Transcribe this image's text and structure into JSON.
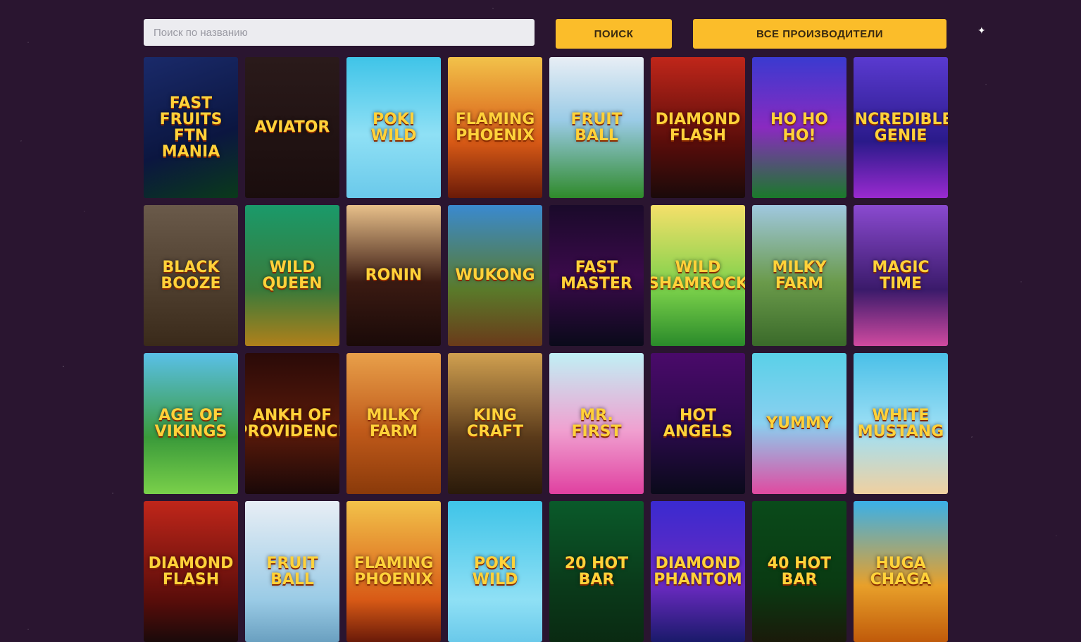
{
  "search": {
    "placeholder": "Поиск по названию",
    "value": ""
  },
  "buttons": {
    "search_label": "ПОИСК",
    "providers_label": "ВСЕ ПРОИЗВОДИТЕЛИ"
  },
  "colors": {
    "background": "#2a1530",
    "accent": "#fbbd2a",
    "input_bg": "#ececf0"
  },
  "games": [
    {
      "title": "Fast Fruits FTN Mania"
    },
    {
      "title": "Aviator"
    },
    {
      "title": "Poki Wild"
    },
    {
      "title": "Flaming Phoenix"
    },
    {
      "title": "Fruit Ball"
    },
    {
      "title": "Diamond Flash"
    },
    {
      "title": "Ho Ho Ho!"
    },
    {
      "title": "Incredible Genie"
    },
    {
      "title": "Black Booze"
    },
    {
      "title": "Wild Queen"
    },
    {
      "title": "Ronin"
    },
    {
      "title": "Wukong"
    },
    {
      "title": "Fast Master"
    },
    {
      "title": "Wild Shamrock"
    },
    {
      "title": "Milky Farm"
    },
    {
      "title": "Magic Time"
    },
    {
      "title": "Age of Vikings"
    },
    {
      "title": "Ankh of Providence"
    },
    {
      "title": "Milky Farm"
    },
    {
      "title": "King Craft"
    },
    {
      "title": "Mr. First"
    },
    {
      "title": "Hot Angels"
    },
    {
      "title": "Yummy"
    },
    {
      "title": "White Mustang"
    },
    {
      "title": "Diamond Flash"
    },
    {
      "title": "Fruit Ball"
    },
    {
      "title": "Flaming Phoenix"
    },
    {
      "title": "Poki Wild"
    },
    {
      "title": "20 Hot Bar"
    },
    {
      "title": "Diamond Phantom"
    },
    {
      "title": "40 Hot Bar"
    },
    {
      "title": "Huga Chaga"
    }
  ]
}
